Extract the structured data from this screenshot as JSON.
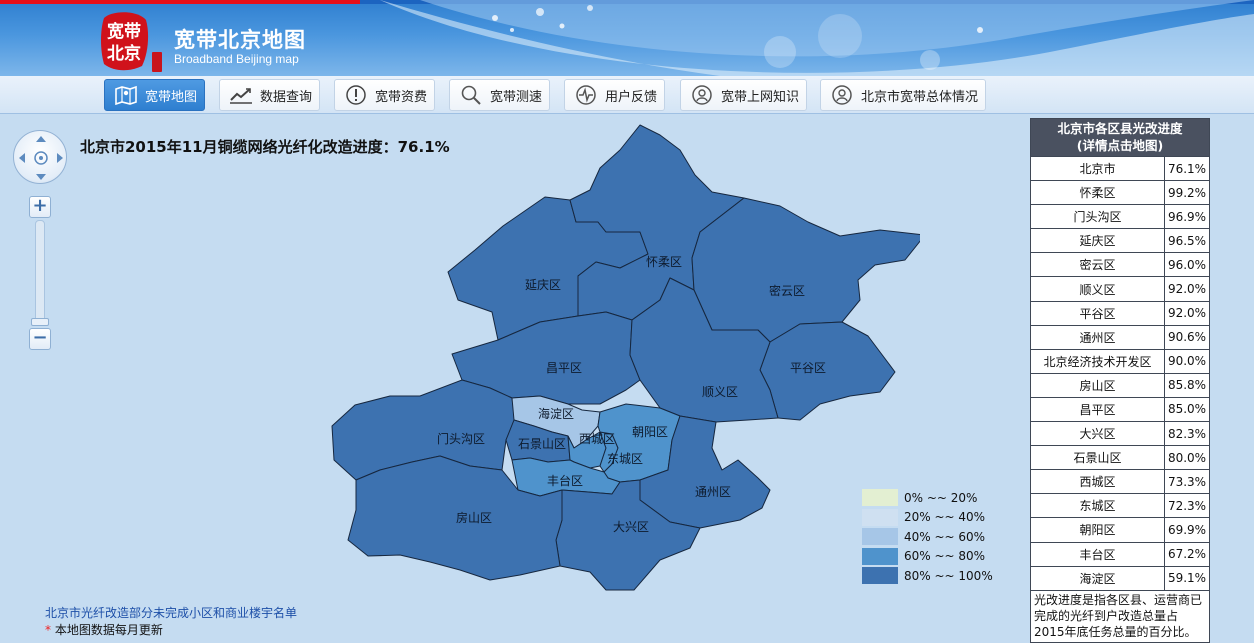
{
  "header": {
    "logo_text": "宽带北京",
    "title": "宽带北京地图",
    "subtitle": "Broadband Beijing map"
  },
  "nav": [
    {
      "label": "宽带地图",
      "icon": "map-icon",
      "active": true
    },
    {
      "label": "数据查询",
      "icon": "chart-icon",
      "active": false
    },
    {
      "label": "宽带资费",
      "icon": "info-icon",
      "active": false
    },
    {
      "label": "宽带测速",
      "icon": "search-icon",
      "active": false
    },
    {
      "label": "用户反馈",
      "icon": "pulse-icon",
      "active": false
    },
    {
      "label": "宽带上网知识",
      "icon": "user-icon",
      "active": false
    },
    {
      "label": "北京市宽带总体情况",
      "icon": "user-icon",
      "active": false
    }
  ],
  "map": {
    "title": "北京市2015年11月铜缆网络光纤化改造进度：76.1%",
    "districts": [
      {
        "name": "延庆区",
        "value": 96.5
      },
      {
        "name": "怀柔区",
        "value": 99.2
      },
      {
        "name": "密云区",
        "value": 96.0
      },
      {
        "name": "昌平区",
        "value": 85.0
      },
      {
        "name": "顺义区",
        "value": 92.0
      },
      {
        "name": "平谷区",
        "value": 92.0
      },
      {
        "name": "门头沟区",
        "value": 96.9
      },
      {
        "name": "海淀区",
        "value": 59.1
      },
      {
        "name": "石景山区",
        "value": 80.0
      },
      {
        "name": "西城区",
        "value": 73.3
      },
      {
        "name": "东城区",
        "value": 72.3
      },
      {
        "name": "朝阳区",
        "value": 69.9
      },
      {
        "name": "丰台区",
        "value": 67.2
      },
      {
        "name": "通州区",
        "value": 90.6
      },
      {
        "name": "大兴区",
        "value": 82.3
      },
      {
        "name": "房山区",
        "value": 85.8
      }
    ]
  },
  "legend": [
    {
      "label": "0% ~~ 20%",
      "color": "#e3efd2"
    },
    {
      "label": "20% ~~ 40%",
      "color": "#cfe0f1"
    },
    {
      "label": "40% ~~ 60%",
      "color": "#a6c6e7"
    },
    {
      "label": "60% ~~ 80%",
      "color": "#4f93cc"
    },
    {
      "label": "80% ~~ 100%",
      "color": "#3d72b0"
    }
  ],
  "notes": {
    "link": "北京市光纤改造部分未完成小区和商业楼宇名单",
    "star": "*",
    "update": "本地图数据每月更新"
  },
  "side": {
    "header_line1": "北京市各区县光改进度",
    "header_line2": "(详情点击地图)",
    "rows": [
      {
        "name": "北京市",
        "value": "76.1%"
      },
      {
        "name": "怀柔区",
        "value": "99.2%"
      },
      {
        "name": "门头沟区",
        "value": "96.9%"
      },
      {
        "name": "延庆区",
        "value": "96.5%"
      },
      {
        "name": "密云区",
        "value": "96.0%"
      },
      {
        "name": "顺义区",
        "value": "92.0%"
      },
      {
        "name": "平谷区",
        "value": "92.0%"
      },
      {
        "name": "通州区",
        "value": "90.6%"
      },
      {
        "name": "北京经济技术开发区",
        "value": "90.0%"
      },
      {
        "name": "房山区",
        "value": "85.8%"
      },
      {
        "name": "昌平区",
        "value": "85.0%"
      },
      {
        "name": "大兴区",
        "value": "82.3%"
      },
      {
        "name": "石景山区",
        "value": "80.0%"
      },
      {
        "name": "西城区",
        "value": "73.3%"
      },
      {
        "name": "东城区",
        "value": "72.3%"
      },
      {
        "name": "朝阳区",
        "value": "69.9%"
      },
      {
        "name": "丰台区",
        "value": "67.2%"
      },
      {
        "name": "海淀区",
        "value": "59.1%"
      }
    ],
    "note": "光改进度是指各区县、运营商已完成的光纤到户改造总量占2015年底任务总量的百分比。"
  }
}
